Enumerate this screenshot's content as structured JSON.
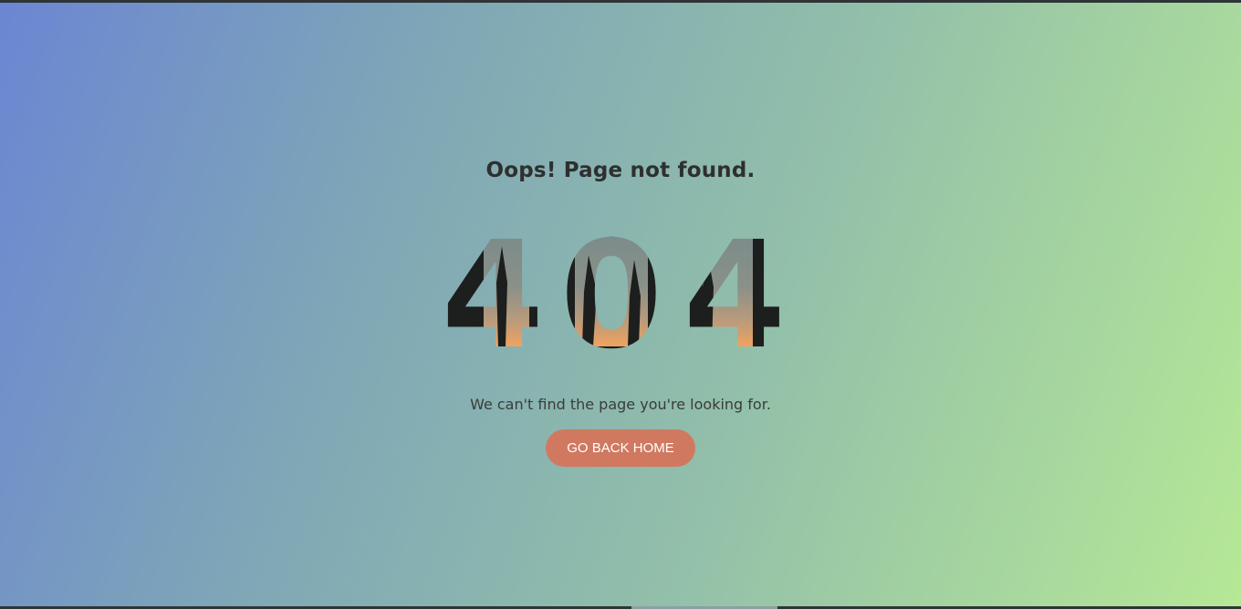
{
  "page": {
    "title": "Oops! Page not found.",
    "error_code": "404",
    "message": "We can't find the page you're looking for.",
    "home_button_label": "GO BACK HOME"
  },
  "colors": {
    "gradient_start": "#6b86d3",
    "gradient_end": "#b6e896",
    "button_bg": "#d07960",
    "button_text": "#ffffff",
    "heading_text": "#2f2f2f"
  }
}
